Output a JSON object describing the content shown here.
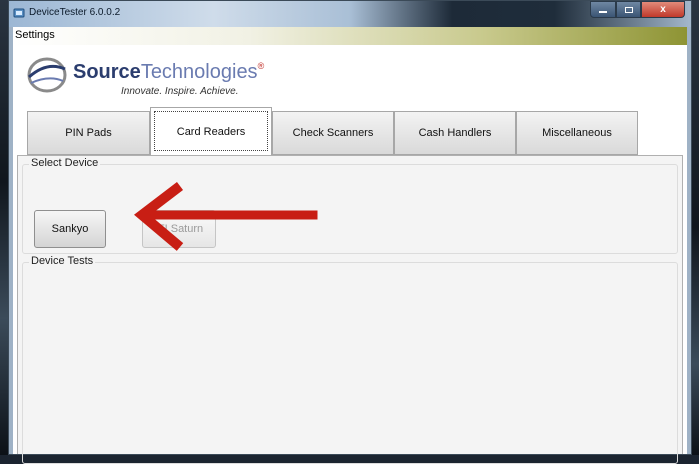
{
  "window": {
    "title": "DeviceTester 6.0.0.2",
    "controls": {
      "minimize": "",
      "maximize": "",
      "close": "x"
    }
  },
  "menubar": {
    "items": [
      {
        "label": "Settings"
      }
    ]
  },
  "logo": {
    "brand_bold": "Source",
    "brand_light": "Technologies",
    "registered": "®",
    "tagline": "Innovate. Inspire. Achieve."
  },
  "tabs": [
    {
      "label": "PIN Pads",
      "active": false
    },
    {
      "label": "Card Readers",
      "active": true
    },
    {
      "label": "Check Scanners",
      "active": false
    },
    {
      "label": "Cash Handlers",
      "active": false
    },
    {
      "label": "Miscellaneous",
      "active": false
    }
  ],
  "select_device": {
    "label": "Select Device",
    "buttons": [
      {
        "label": "Sankyo",
        "enabled": true
      },
      {
        "label": "ITI Saturn",
        "enabled": false
      }
    ]
  },
  "device_tests": {
    "label": "Device Tests"
  },
  "annotation": {
    "icon": "red-arrow-icon",
    "color": "#c81e14"
  }
}
